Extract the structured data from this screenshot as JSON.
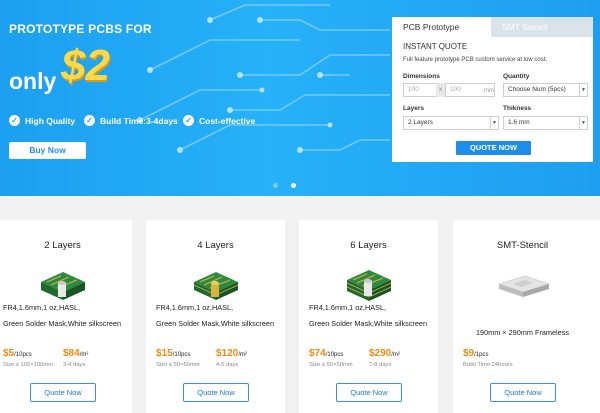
{
  "hero": {
    "heading": "PROTOTYPE PCBS FOR",
    "only": "only",
    "price": "$2",
    "features": [
      "High Quality",
      "Build Time:3-4days",
      "Cost-effective"
    ],
    "buy_label": "Buy  Now"
  },
  "quote": {
    "tabs": [
      "PCB Prototype",
      "SMT Stencil"
    ],
    "title": "INSTANT QUOTE",
    "description": "Full feature prototype PCB custom service at low cost.",
    "dimensions_label": "Dimensions",
    "dim_w_placeholder": "100",
    "dim_x": "x",
    "dim_h_placeholder": "100",
    "dim_unit": "mm",
    "quantity_label": "Quantity",
    "quantity_value": "Choose Num (5pcs)",
    "layers_label": "Layers",
    "layers_value": "2 Layers",
    "thickness_label": "Thikness",
    "thickness_value": "1.6 mm",
    "button": "QUOTE NOW"
  },
  "cards": [
    {
      "title": "2 Layers",
      "spec1": "FR4,1.6mm,1 oz,HASL,",
      "spec2": "Green Solder Mask,White silkscreen",
      "price1": "$5",
      "unit1": "/10pcs",
      "price2": "$84",
      "unit2": "/m²",
      "size": "Size ≤ 100×100mm",
      "days": "3-4 days",
      "button": "Quote Now"
    },
    {
      "title": "4 Layers",
      "spec1": "FR4,1.6mm,1 oz,HASL,",
      "spec2": "Green Solder Mask,White silkscreen",
      "price1": "$15",
      "unit1": "/10pcs",
      "price2": "$120",
      "unit2": "/m²",
      "size": "Size ≤ 50×50mm",
      "days": "4-5 days",
      "button": "Quote Now"
    },
    {
      "title": "6 Layers",
      "spec1": "FR4,1.6mm,1 oz,HASL,",
      "spec2": "Green Solder Mask,White silkscreen",
      "price1": "$74",
      "unit1": "/10pcs",
      "price2": "$290",
      "unit2": "/m²",
      "size": "Size ≤ 50×50mm",
      "days": "7-8 days",
      "button": "Quote Now"
    },
    {
      "title": "SMT-Stencil",
      "spec1": "190mm × 290mm Frameless",
      "price1": "$9",
      "unit1": "/1pcs",
      "size": "Build Time:24hours",
      "button": "Quote Now"
    }
  ],
  "colors": {
    "accent": "#1e8eea",
    "price": "#f08a10",
    "hero_blue": "#22a8f5",
    "gold": "#ffd94a"
  }
}
